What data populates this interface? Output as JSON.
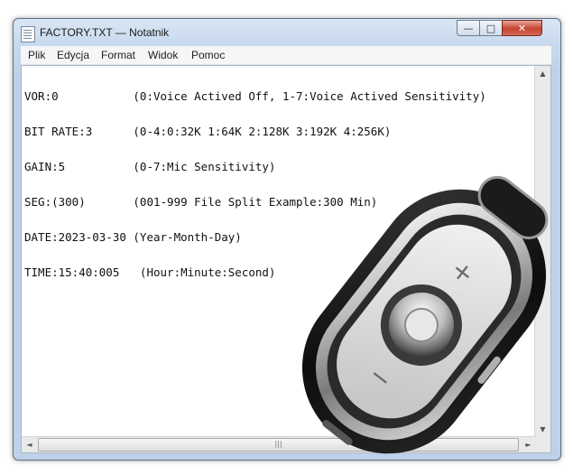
{
  "window": {
    "title": "FACTORY.TXT — Notatnik",
    "buttons": {
      "minimize": "—",
      "maximize": "□",
      "close": "✕"
    }
  },
  "menu": {
    "items": [
      {
        "label": "Plik"
      },
      {
        "label": "Edycja"
      },
      {
        "label": "Format"
      },
      {
        "label": "Widok"
      },
      {
        "label": "Pomoc"
      }
    ]
  },
  "document": {
    "lines": [
      "VOR:0           (0:Voice Actived Off, 1-7:Voice Actived Sensitivity)",
      "BIT RATE:3      (0-4:0:32K 1:64K 2:128K 3:192K 4:256K)",
      "GAIN:5          (0-7:Mic Sensitivity)",
      "SEG:(300)       (001-999 File Split Example:300 Min)",
      "DATE:2023-03-30 (Year-Month-Day)",
      "TIME:15:40:005   (Hour:Minute:Second)"
    ]
  },
  "icons": {
    "app": "notepad-icon",
    "scroll_up": "▲",
    "scroll_down": "▼",
    "scroll_left": "◄",
    "scroll_right": "►",
    "grip": "|||"
  },
  "device_marks": {
    "plus": "+",
    "minus": "−"
  },
  "colors": {
    "close_button": "#c7432f",
    "title_bar": "#c7d9ee",
    "device_body": "#1a1a1a",
    "device_chrome": "#c9c9c9"
  }
}
